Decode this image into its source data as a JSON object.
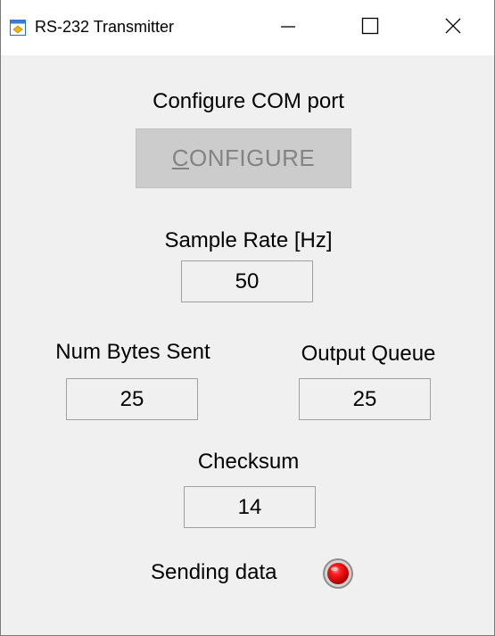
{
  "window": {
    "title": "RS-232 Transmitter"
  },
  "configure": {
    "label": "Configure COM port",
    "button_mnemonic": "C",
    "button_rest": "ONFIGURE"
  },
  "sample_rate": {
    "label": "Sample Rate [Hz]",
    "value": "50"
  },
  "num_bytes_sent": {
    "label": "Num Bytes Sent",
    "value": "25"
  },
  "output_queue": {
    "label": "Output Queue",
    "value": "25"
  },
  "checksum": {
    "label": "Checksum",
    "value": "14"
  },
  "status": {
    "label": "Sending data",
    "led_color": "#e00000",
    "led_on": true
  },
  "icons": {
    "app": "app-window-icon",
    "minimize": "minimize-icon",
    "maximize": "maximize-icon",
    "close": "close-icon"
  }
}
